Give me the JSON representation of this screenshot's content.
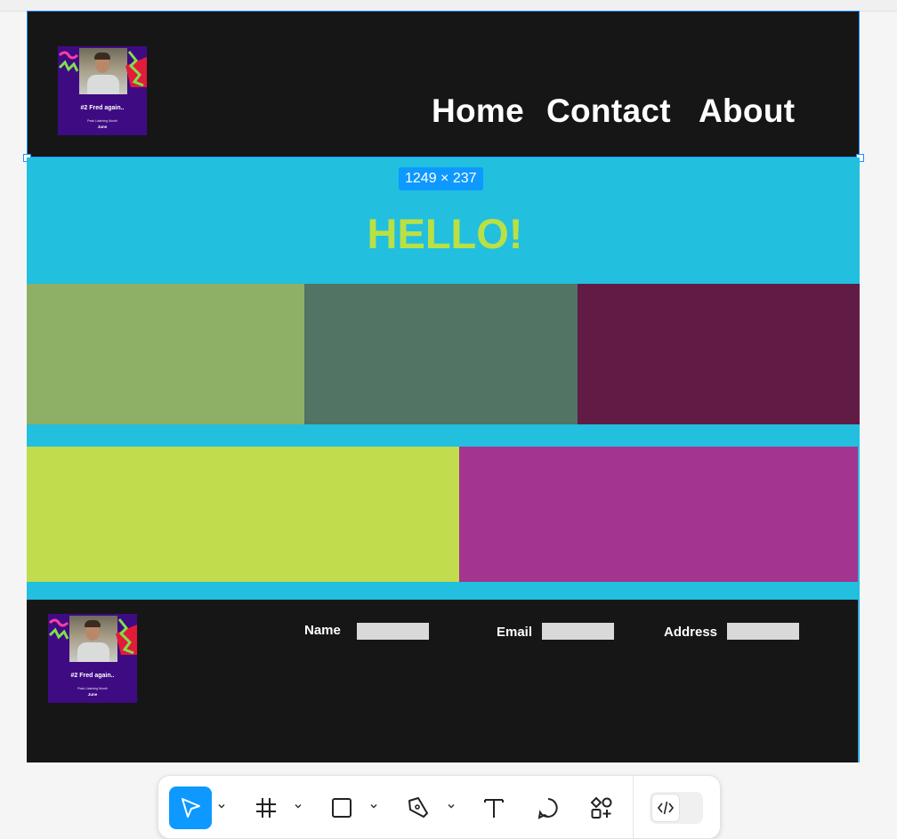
{
  "header": {
    "album": {
      "title": "#2 Fred again..",
      "subtitle": "Peak Listening Month",
      "month": "June"
    },
    "nav": [
      {
        "label": "Home"
      },
      {
        "label": "Contact"
      },
      {
        "label": "About"
      }
    ]
  },
  "selection": {
    "dimensions": "1249 × 237"
  },
  "hero": {
    "heading": "HELLO!"
  },
  "colors": {
    "header_bg": "#171617",
    "hero_bg": "#22bfdf",
    "heading": "#b9e045",
    "block_1": "#8eb066",
    "block_2": "#517464",
    "block_3": "#611c46",
    "block_4": "#c1dc4d",
    "block_5": "#a3348f",
    "accent": "#0d99ff",
    "album_bg": "#3f0b83"
  },
  "footer": {
    "album": {
      "title": "#2 Fred again..",
      "subtitle": "Peak Listening Month",
      "month": "June"
    },
    "fields": [
      {
        "label": "Name",
        "value": ""
      },
      {
        "label": "Email",
        "value": ""
      },
      {
        "label": "Address",
        "value": ""
      }
    ]
  },
  "toolbar": {
    "tools": [
      "move-tool",
      "frame-tool",
      "rectangle-tool",
      "pen-tool",
      "text-tool",
      "comment-tool",
      "components-tool"
    ],
    "active": "move-tool",
    "dev_mode": "code-icon"
  }
}
